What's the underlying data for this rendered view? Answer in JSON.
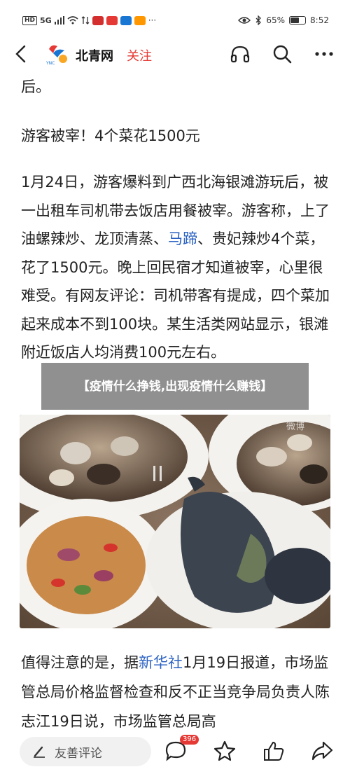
{
  "status_bar": {
    "left_text": "HD",
    "signal_text": "5G",
    "battery_text": "65%",
    "time": "8:52",
    "battery_level": 0.65,
    "app_badge_colors": [
      "#d32f2f",
      "#e53935",
      "#1976d2",
      "#ff9800"
    ]
  },
  "nav": {
    "site_name": "北青网",
    "follow_label": "关注",
    "icons": [
      "back-arrow-icon",
      "headphones-icon",
      "search-icon",
      "more-icon"
    ]
  },
  "article": {
    "tail_text": "后。",
    "headline": "游客被宰！4个菜花1500元",
    "main_before_link": "1月24日，游客爆料到广西北海银滩游玩后，被一出租车司机带去饭店用餐被宰。游客称，上了油螺辣炒、龙顶清蒸、",
    "main_link": "马蹄",
    "main_after_link": "、贵妃辣炒4个菜，花了1500元。晚上回民宿才知道被宰，心里很难受。有网友评论：司机带客有提成，四个菜加起来成本不到100块。某生活类网站显示，银滩附近饭店人均消费100元左右。",
    "bottom_before_link": "值得注意的是，据",
    "bottom_link": "新华社",
    "bottom_after_link": "1月19日报道，市场监管总局价格监督检查和反不正当竞争局负责人陈志江19日说，市场监管总局高"
  },
  "overlay": {
    "text": "【疫情什么挣钱,出现疫情什么赚钱】"
  },
  "photo": {
    "watermark": "微博"
  },
  "bottom_bar": {
    "comment_placeholder": "友善评论",
    "comment_count": "396",
    "accent_color": "#e53935"
  }
}
